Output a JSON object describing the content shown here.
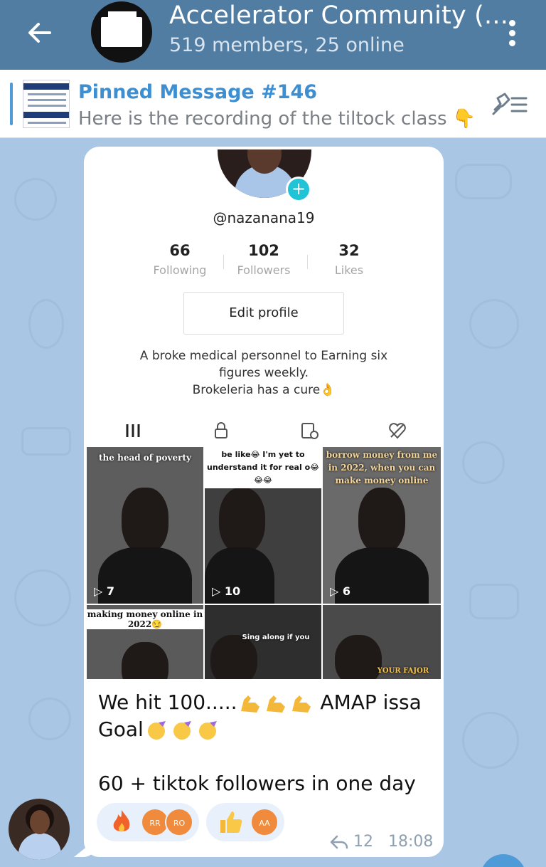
{
  "header": {
    "title": "Accelerator Community (...",
    "subtitle": "519 members, 25 online"
  },
  "pinned": {
    "title": "Pinned Message #146",
    "text": "Here is the recording of the tiltock class 👇..."
  },
  "message": {
    "profile": {
      "handle": "@nazanana19",
      "stats": [
        {
          "value": "66",
          "label": "Following"
        },
        {
          "value": "102",
          "label": "Followers"
        },
        {
          "value": "32",
          "label": "Likes"
        }
      ],
      "edit_label": "Edit profile",
      "bio_line1": "A broke medical personnel to Earning six",
      "bio_line2": "figures weekly.",
      "bio_line3": "Brokeleria has a cure👌",
      "videos": [
        {
          "caption": "the head of poverty",
          "views": "7"
        },
        {
          "caption": "be like😂 I'm yet to understand it for real o😂😂😂",
          "views": "10"
        },
        {
          "caption": "borrow money from me in 2022, when you can make money online",
          "views": "6"
        },
        {
          "caption": "making money online in 2022😏",
          "views": ""
        },
        {
          "caption": "Sing along if you",
          "views": ""
        },
        {
          "caption": "YOUR FAJOR",
          "views": ""
        }
      ]
    },
    "caption_line1": "We hit 100.....",
    "caption_after_emojis": " AMAP issa",
    "caption_line2": "Goal",
    "caption_line3": "60 + tiktok followers in one day",
    "reactions": [
      {
        "emoji": "fire-icon",
        "avatars": [
          "RR",
          "RO"
        ]
      },
      {
        "emoji": "thumbs-up-icon",
        "avatars": [
          "AA"
        ]
      }
    ],
    "forwards": "12",
    "time": "18:08"
  },
  "colors": {
    "header_bg": "#527da3",
    "wallpaper": "#a9c6e4",
    "accent": "#3d8fd1",
    "tiktok_plus": "#20c4d6",
    "reaction_avatar": "#f08a3c"
  }
}
